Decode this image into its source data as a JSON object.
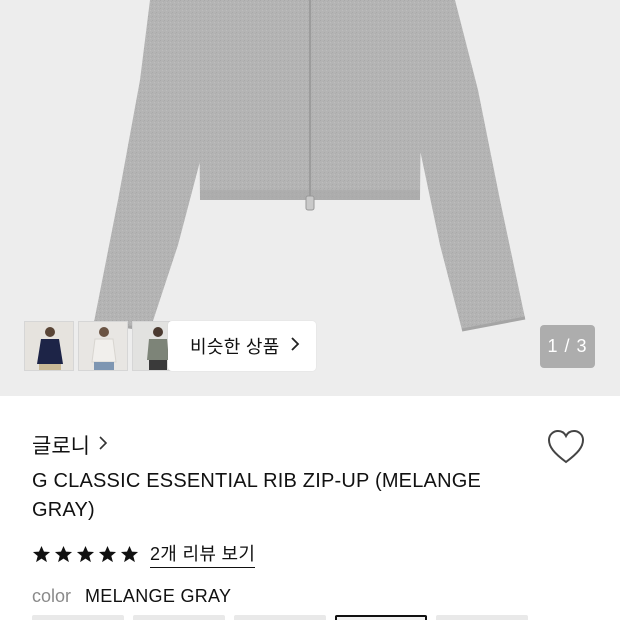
{
  "image": {
    "pager_text": "1 / 3",
    "current_page": 1,
    "total_pages": 3
  },
  "similar": {
    "label": "비슷한 상품",
    "thumbnails": [
      {
        "name": "navy-cardigan"
      },
      {
        "name": "white-cardigan"
      },
      {
        "name": "gray-zipup"
      }
    ]
  },
  "product": {
    "brand": "글로니",
    "title": "G CLASSIC ESSENTIAL RIB ZIP-UP (MELANGE GRAY)",
    "rating_stars": 5,
    "review_link": "2개 리뷰 보기",
    "color_label": "color",
    "color_value": "MELANGE GRAY"
  },
  "icons": {
    "brand_chevron": "chevron-right-icon",
    "similar_chevron": "chevron-right-icon",
    "wishlist": "heart-outline-icon",
    "star": "star-filled-icon"
  },
  "colors": {
    "hero_bg": "#ededed",
    "garment": "#b3b3b3",
    "accent": "#111111",
    "muted": "#8a8a8a"
  }
}
